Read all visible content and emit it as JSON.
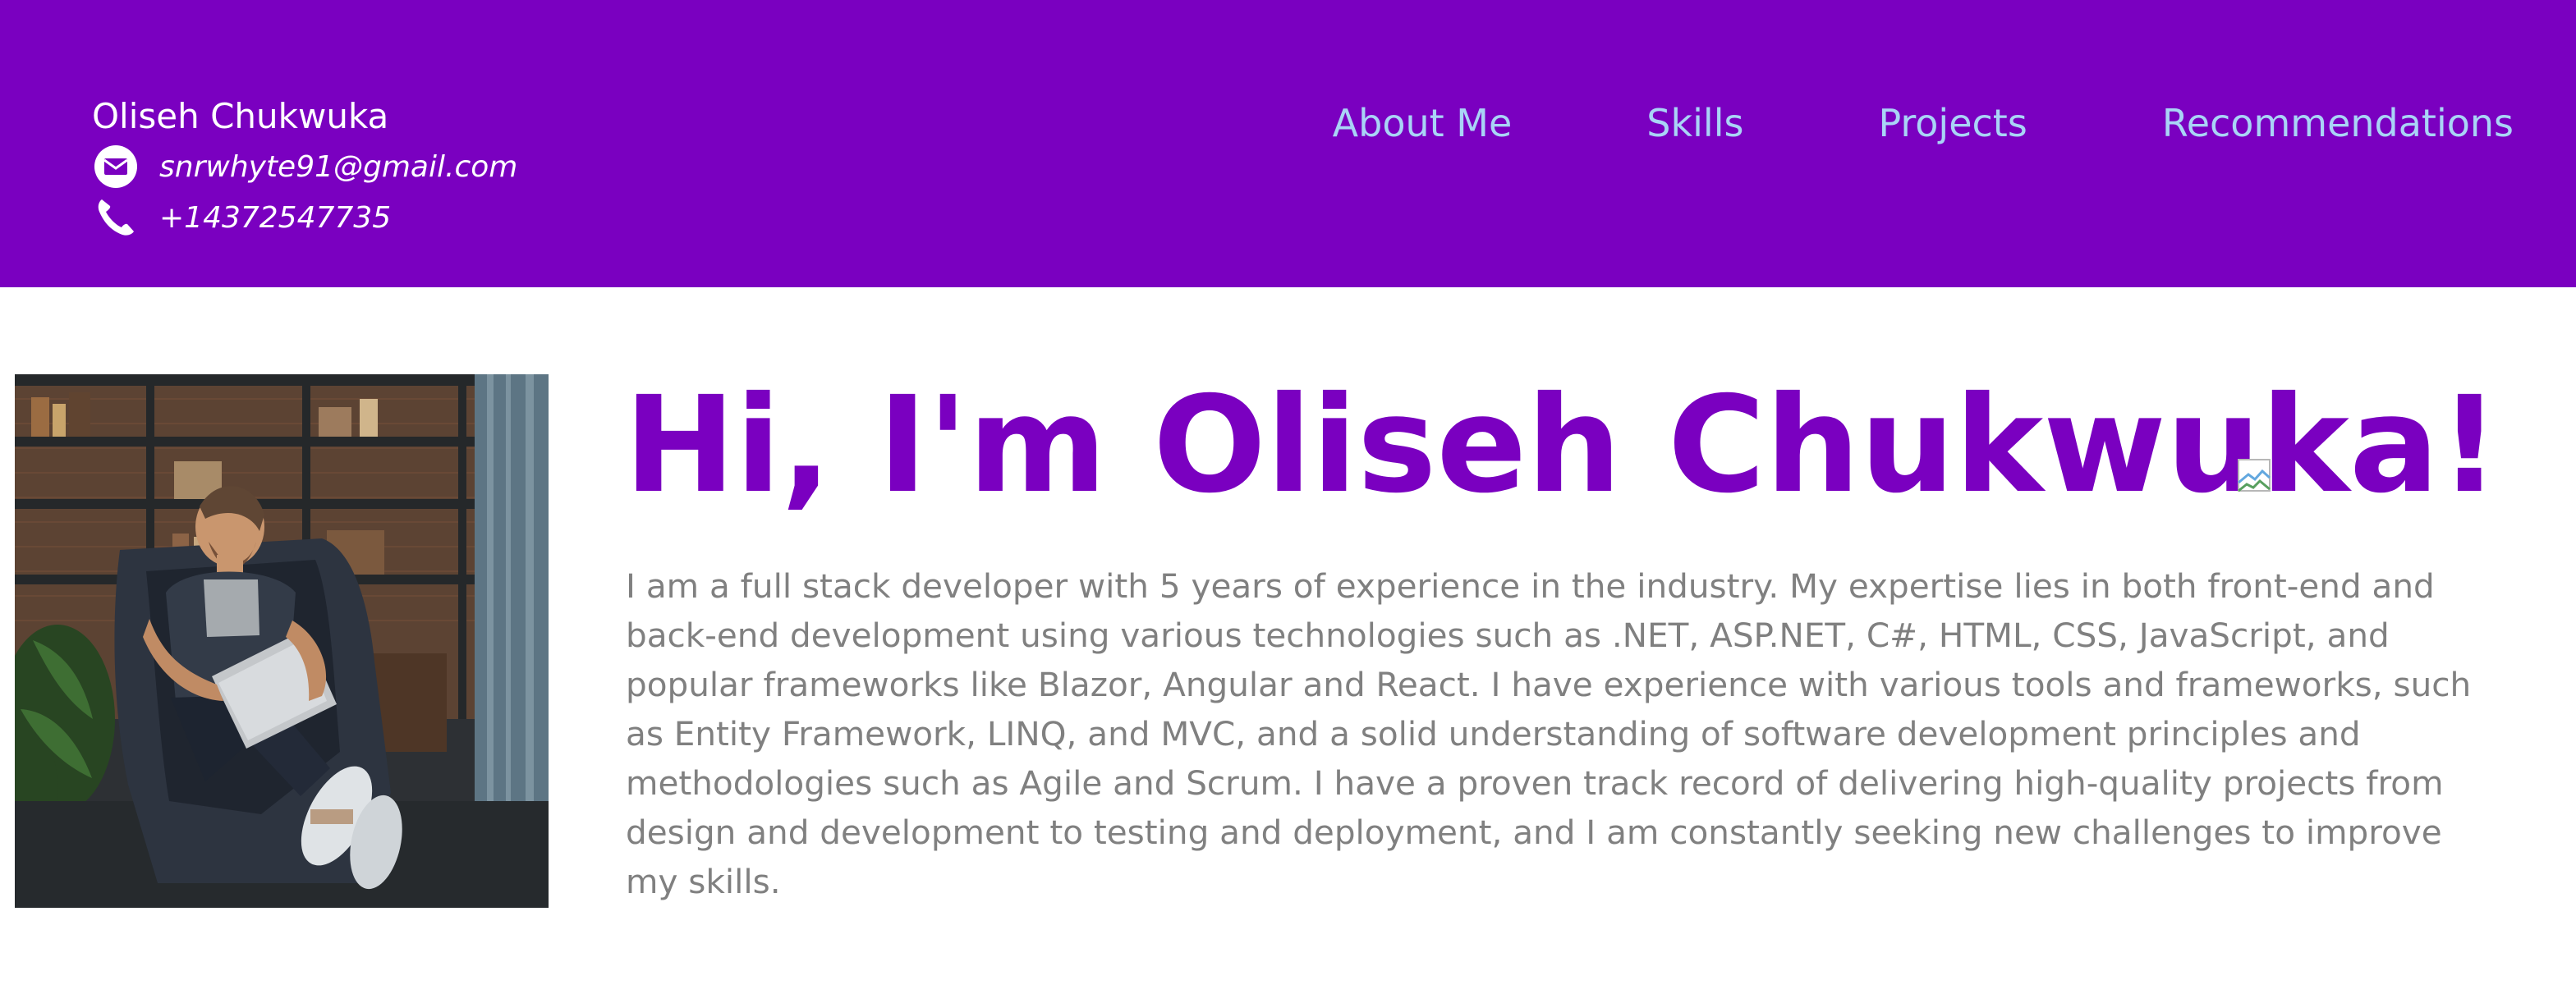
{
  "header": {
    "name": "Oliseh Chukwuka",
    "email": "snrwhyte91@gmail.com",
    "phone": "+14372547735",
    "nav": [
      "About Me",
      "Skills",
      "Projects",
      "Recommendations"
    ],
    "background_color": "#7a00c0",
    "nav_color": "#a9d4f6",
    "icons": [
      "envelope-icon",
      "phone-icon"
    ]
  },
  "hero": {
    "title": "Hi, I'm Oliseh Chukwuka!",
    "title_color": "#7a00c0",
    "bio": "I am a full stack developer with 5 years of experience in the industry. My expertise lies in both front-end and back-end development using various technologies such as .NET, ASP.NET, C#, HTML, CSS, JavaScript, and popular frameworks like Blazor, Angular and React. I have experience with various tools and frameworks, such as Entity Framework, LINQ, and MVC, and a solid understanding of software development principles and methodologies such as Agile and Scrum. I have a proven track record of delivering high-quality projects from design and development to testing and deployment, and I am constantly seeking new challenges to improve my skills.",
    "bio_color": "#808080"
  }
}
